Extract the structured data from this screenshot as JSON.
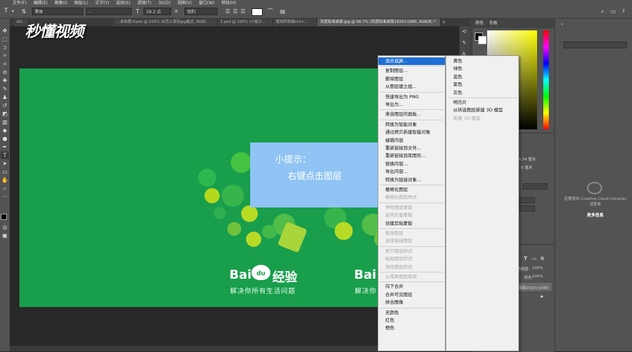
{
  "menubar": {
    "items": [
      "文件(F)",
      "编辑(E)",
      "图像(I)",
      "图层(L)",
      "文字(Y)",
      "选择(S)",
      "滤镜(T)",
      "3D(D)",
      "视图(V)",
      "窗口(W)",
      "帮助(H)"
    ]
  },
  "options": {
    "font_family": "黑体",
    "font_style": "-",
    "font_size": "19.2 点",
    "antialias": "锐利"
  },
  "tabs": [
    {
      "label": "AD...",
      "active": false
    },
    {
      "label": "...未标题-P.psd @ 100% (R怎么保存jpg格式, RGB/...",
      "active": false
    },
    {
      "label": "1.psd @ 100% (小提示...",
      "active": false
    },
    {
      "label": "使用转换键ctrl+...",
      "active": false
    },
    {
      "label": "百度标准桌面.jpg @ 66.7% (百度标准桌面1920×1080, RGB/8) *",
      "active": true
    }
  ],
  "watermark": "秒懂视频",
  "tip": {
    "title": "小提示：",
    "body": "右键点击图层"
  },
  "artboard": {
    "brand_left": "Bai",
    "brand_du": "du",
    "brand_right": "经验",
    "slogan": "解决你所有生活问题",
    "brand_left_2": "Bai",
    "slogan_2": "解决你"
  },
  "context_menu": [
    {
      "label": "混合选项...",
      "state": "highlight",
      "sep_before": false
    },
    {
      "label": "复制图层...",
      "state": "normal",
      "sep_before": true
    },
    {
      "label": "删除图层",
      "state": "normal",
      "sep_before": false
    },
    {
      "label": "从图层建立组...",
      "state": "normal",
      "sep_before": false
    },
    {
      "label": "快速导出为 PNG",
      "state": "normal",
      "sep_before": true
    },
    {
      "label": "导出为...",
      "state": "normal",
      "sep_before": false
    },
    {
      "label": "来自图层的画板...",
      "state": "normal",
      "sep_before": true
    },
    {
      "label": "转换为智能对象",
      "state": "normal",
      "sep_before": true
    },
    {
      "label": "通过拷贝新建智能对象",
      "state": "normal",
      "sep_before": false
    },
    {
      "label": "编辑内容",
      "state": "normal",
      "sep_before": false
    },
    {
      "label": "重新链接到文件...",
      "state": "normal",
      "sep_before": false
    },
    {
      "label": "重新链接到库图形...",
      "state": "normal",
      "sep_before": false
    },
    {
      "label": "替换内容...",
      "state": "normal",
      "sep_before": false
    },
    {
      "label": "导出内容...",
      "state": "normal",
      "sep_before": false
    },
    {
      "label": "转换为链接对象...",
      "state": "normal",
      "sep_before": false
    },
    {
      "label": "栅格化图层",
      "state": "normal",
      "sep_before": true
    },
    {
      "label": "栅格化图层样式",
      "state": "disabled",
      "sep_before": false
    },
    {
      "label": "停用图层蒙版",
      "state": "disabled",
      "sep_before": true
    },
    {
      "label": "启用矢量蒙版",
      "state": "disabled",
      "sep_before": false
    },
    {
      "label": "创建剪贴蒙版",
      "state": "normal",
      "sep_before": false
    },
    {
      "label": "链接图层",
      "state": "disabled",
      "sep_before": true
    },
    {
      "label": "选择链接图层",
      "state": "disabled",
      "sep_before": false
    },
    {
      "label": "拷贝图层样式",
      "state": "disabled",
      "sep_before": true
    },
    {
      "label": "粘贴图层样式",
      "state": "disabled",
      "sep_before": false
    },
    {
      "label": "清除图层样式",
      "state": "disabled",
      "sep_before": false
    },
    {
      "label": "从隔离图层释放",
      "state": "disabled",
      "sep_before": true
    },
    {
      "label": "向下合并",
      "state": "normal",
      "sep_before": true
    },
    {
      "label": "合并可见图层",
      "state": "normal",
      "sep_before": false
    },
    {
      "label": "拼合图像",
      "state": "normal",
      "sep_before": false
    },
    {
      "label": "无颜色",
      "state": "normal",
      "sep_before": true
    },
    {
      "label": "红色",
      "state": "normal",
      "sep_before": false
    },
    {
      "label": "橙色",
      "state": "normal",
      "sep_before": false
    }
  ],
  "submenu": [
    {
      "label": "黄色",
      "state": "normal",
      "sep_before": false
    },
    {
      "label": "绿色",
      "state": "normal",
      "sep_before": false
    },
    {
      "label": "蓝色",
      "state": "normal",
      "sep_before": false
    },
    {
      "label": "紫色",
      "state": "normal",
      "sep_before": false
    },
    {
      "label": "灰色",
      "state": "normal",
      "sep_before": false
    },
    {
      "label": "明信片",
      "state": "normal",
      "sep_before": true
    },
    {
      "label": "从所选图层新建 3D 模型",
      "state": "normal",
      "sep_before": false
    },
    {
      "label": "新建 3D 模型",
      "state": "disabled",
      "sep_before": false
    }
  ],
  "color_panel": {
    "tab1": "颜色",
    "tab2": "色板"
  },
  "props": {
    "w_val": "9.34 厘米",
    "h_val": "0 厘米",
    "opacity_label": "透明度:",
    "opacity_val": "100%",
    "fill_label": "填充:",
    "fill_val": "100%",
    "layer_name": "桌面1920×1080"
  },
  "libraries": {
    "message": "若要使用 Creative Cloud Libraries 请登录",
    "more_link": "更多信息"
  }
}
